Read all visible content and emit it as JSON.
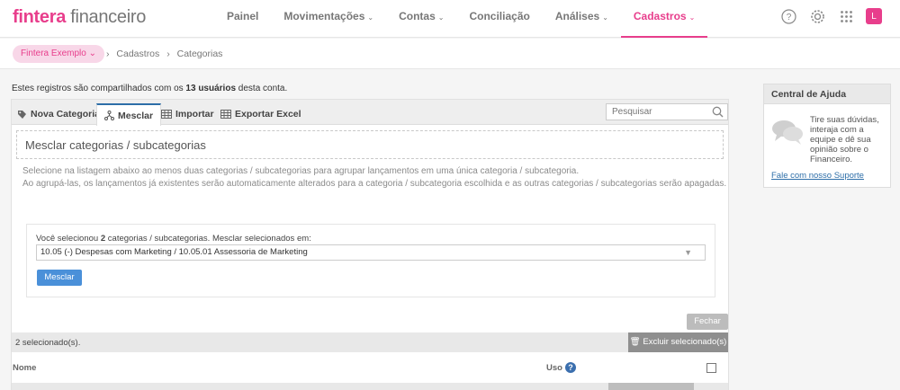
{
  "brand": {
    "name_bold": "fintera",
    "name_light": "financeiro"
  },
  "nav": {
    "items": [
      {
        "label": "Painel",
        "has_dropdown": false
      },
      {
        "label": "Movimentações",
        "has_dropdown": true
      },
      {
        "label": "Contas",
        "has_dropdown": true
      },
      {
        "label": "Conciliação",
        "has_dropdown": false
      },
      {
        "label": "Análises",
        "has_dropdown": true
      },
      {
        "label": "Cadastros",
        "has_dropdown": true,
        "active": true
      }
    ],
    "icons": [
      "help-icon",
      "gear-icon",
      "apps-grid-icon"
    ],
    "avatar_initial": "L"
  },
  "breadcrumb": {
    "company": "Fintera Exemplo",
    "items": [
      "Cadastros",
      "Categorias"
    ]
  },
  "notice": {
    "prefix": "Estes registros são compartilhados com os ",
    "highlight": "13 usuários",
    "suffix": " desta conta."
  },
  "tabs": [
    {
      "label": "Nova Categoria",
      "icon": "tag-icon"
    },
    {
      "label": "Mesclar",
      "icon": "merge-icon",
      "active": true
    },
    {
      "label": "Importar",
      "icon": "table-icon"
    },
    {
      "label": "Exportar Excel",
      "icon": "table-icon"
    }
  ],
  "search": {
    "placeholder": "Pesquisar"
  },
  "merge": {
    "title": "Mesclar categorias / subcategorias",
    "desc_line1": "Selecione na listagem abaixo ao menos duas categorias / subcategorias para agrupar lançamentos em uma única categoria / subcategoria.",
    "desc_line2": "Ao agrupá-las, os lançamentos já existentes serão automaticamente alterados para a categoria / subcategoria escolhida e as outras categorias / subcategorias serão apagadas.",
    "selected_prefix": "Você selecionou ",
    "selected_count": "2",
    "selected_suffix": " categorias / subcategorias. Mesclar selecionados em:",
    "dropdown_value": "10.05 (-) Despesas com Marketing / 10.05.01 Assessoria de Marketing",
    "merge_button": "Mesclar"
  },
  "close_button": "Fechar",
  "list": {
    "selected_text": "2 selecionado(s).",
    "delete_button": "Excluir selecionado(s)",
    "col_name": "Nome",
    "col_usage": "Uso"
  },
  "help": {
    "title": "Central de Ajuda",
    "text": "Tire suas dúvidas, interaja com a equipe e dê sua opinião sobre o Financeiro.",
    "link": "Fale com nosso Suporte"
  },
  "colors": {
    "brand_pink": "#e83e8c",
    "primary_blue": "#4a90d9"
  }
}
